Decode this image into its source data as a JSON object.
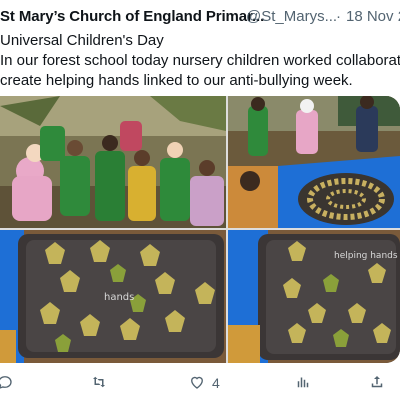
{
  "tweet": {
    "author_name": "St Mary’s Church of England Primar...",
    "handle": "@St_Marys...",
    "separator": "·",
    "time": "18 Nov 2",
    "text_lines": [
      "Universal Children's Day",
      "In our forest school today nursery children worked collaborativel",
      "create helping hands linked to our anti-bullying week."
    ]
  },
  "media": {
    "images": [
      {
        "name": "children-in-forest"
      },
      {
        "name": "leaf-circle-on-tarp"
      },
      {
        "name": "leaf-hands-tray"
      },
      {
        "name": "leaf-hands-tray-close"
      }
    ],
    "tray_text_1": "hands",
    "tray_text_2": "helping hands"
  },
  "actions": {
    "reply_icon": "reply-icon",
    "retweet_icon": "retweet-icon",
    "like_icon": "heart-icon",
    "like_count": "4",
    "views_icon": "views-icon",
    "share_icon": "share-icon"
  },
  "colors": {
    "text": "#0f1419",
    "secondary": "#536471",
    "tarp_blue": "#1e6fd6"
  }
}
